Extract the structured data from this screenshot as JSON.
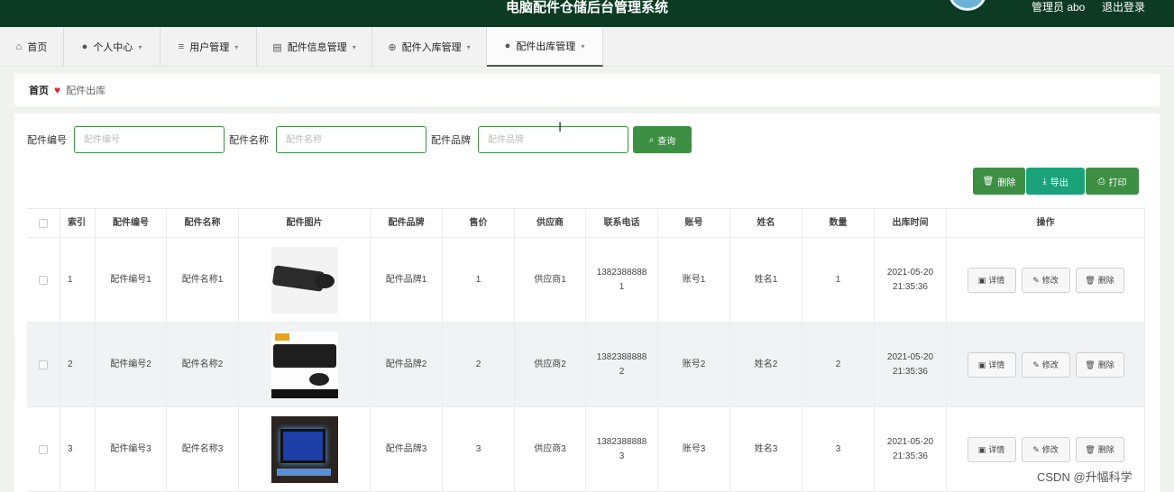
{
  "header": {
    "title": "电脑配件仓储后台管理系统",
    "user": "管理员 abo",
    "logout": "退出登录"
  },
  "nav": [
    {
      "icon": "home-icon",
      "label": "首页"
    },
    {
      "icon": "user-icon",
      "label": "个人中心"
    },
    {
      "icon": "list-icon",
      "label": "用户管理"
    },
    {
      "icon": "box-icon",
      "label": "配件信息管理"
    },
    {
      "icon": "gear-icon",
      "label": "配件入库管理"
    },
    {
      "icon": "user-icon",
      "label": "配件出库管理"
    }
  ],
  "breadcrumb": {
    "home": "首页",
    "current": "配件出库"
  },
  "search": {
    "code_label": "配件编号",
    "code_placeholder": "配件编号",
    "name_label": "配件名称",
    "name_placeholder": "配件名称",
    "brand_label": "配件品牌",
    "brand_placeholder": "配件品牌",
    "query_button": "查询"
  },
  "actions": {
    "delete": "删除",
    "export": "导出",
    "print": "打印"
  },
  "table": {
    "columns": [
      "索引",
      "配件编号",
      "配件名称",
      "配件图片",
      "配件品牌",
      "售价",
      "供应商",
      "联系电话",
      "账号",
      "姓名",
      "数量",
      "出库时间",
      "操作"
    ],
    "rows": [
      {
        "index": "1",
        "code": "配件编号1",
        "name": "配件名称1",
        "brand": "配件品牌1",
        "price": "1",
        "supplier": "供应商1",
        "phone_a": "1382388888",
        "phone_b": "1",
        "account": "账号1",
        "person": "姓名1",
        "qty": "1",
        "date": "2021-05-20",
        "time": "21:35:36"
      },
      {
        "index": "2",
        "code": "配件编号2",
        "name": "配件名称2",
        "brand": "配件品牌2",
        "price": "2",
        "supplier": "供应商2",
        "phone_a": "1382388888",
        "phone_b": "2",
        "account": "账号2",
        "person": "姓名2",
        "qty": "2",
        "date": "2021-05-20",
        "time": "21:35:36"
      },
      {
        "index": "3",
        "code": "配件编号3",
        "name": "配件名称3",
        "brand": "配件品牌3",
        "price": "3",
        "supplier": "供应商3",
        "phone_a": "1382388888",
        "phone_b": "3",
        "account": "账号3",
        "person": "姓名3",
        "qty": "3",
        "date": "2021-05-20",
        "time": "21:35:36"
      }
    ],
    "row_ops": {
      "detail": "详情",
      "edit": "修改",
      "delete": "删除"
    }
  },
  "watermark": "CSDN @升幅科学",
  "colors": {
    "header_bg": "#0d3a23",
    "primary": "#3d8f43",
    "export": "#1aa37a"
  }
}
